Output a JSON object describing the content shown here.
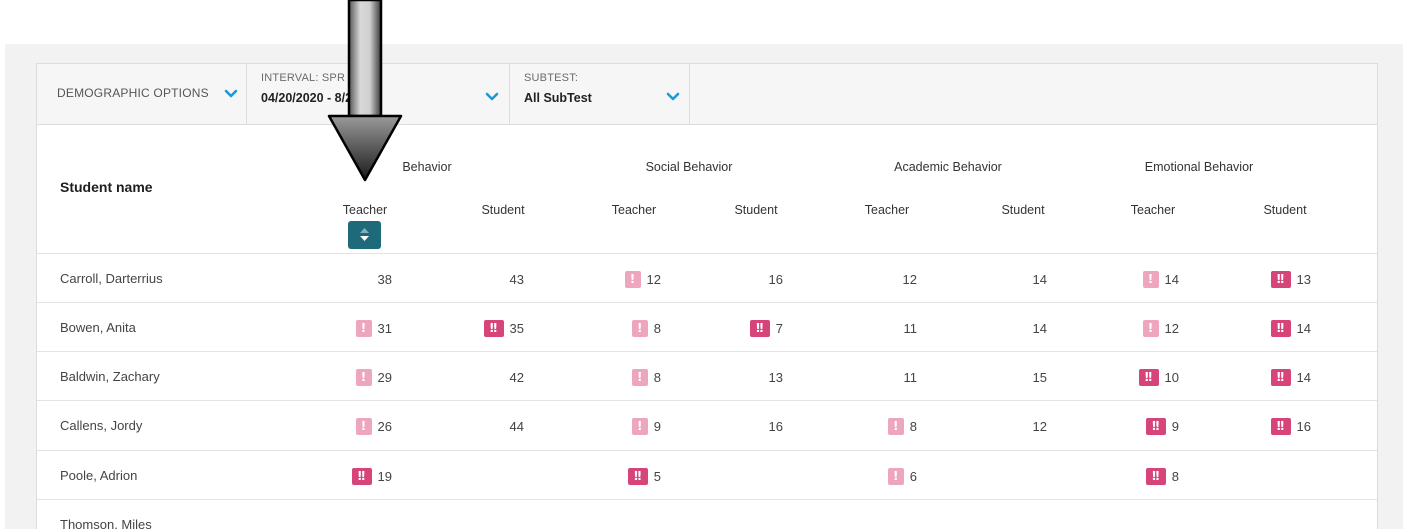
{
  "filters": {
    "demographic": {
      "label": "DEMOGRAPHIC OPTIONS"
    },
    "interval": {
      "label": "INTERVAL: SPR",
      "value": "04/20/2020 - 8/2020"
    },
    "subtest": {
      "label": "SUBTEST:",
      "value": "All SubTest"
    }
  },
  "table": {
    "name_header": "Student name",
    "groups": [
      "Behavior",
      "Social Behavior",
      "Academic Behavior",
      "Emotional Behavior"
    ],
    "subheaders": [
      "Teacher",
      "Student",
      "Teacher",
      "Student",
      "Teacher",
      "Student",
      "Teacher",
      "Student"
    ],
    "rows": [
      {
        "name": "Carroll, Darterrius",
        "cells": [
          {
            "v": "38",
            "f": ""
          },
          {
            "v": "43",
            "f": ""
          },
          {
            "v": "12",
            "f": "!"
          },
          {
            "v": "16",
            "f": ""
          },
          {
            "v": "12",
            "f": ""
          },
          {
            "v": "14",
            "f": ""
          },
          {
            "v": "14",
            "f": "!"
          },
          {
            "v": "13",
            "f": "!!"
          }
        ]
      },
      {
        "name": "Bowen, Anita",
        "cells": [
          {
            "v": "31",
            "f": "!"
          },
          {
            "v": "35",
            "f": "!!"
          },
          {
            "v": "8",
            "f": "!"
          },
          {
            "v": "7",
            "f": "!!"
          },
          {
            "v": "11",
            "f": ""
          },
          {
            "v": "14",
            "f": ""
          },
          {
            "v": "12",
            "f": "!"
          },
          {
            "v": "14",
            "f": "!!"
          }
        ]
      },
      {
        "name": "Baldwin, Zachary",
        "cells": [
          {
            "v": "29",
            "f": "!"
          },
          {
            "v": "42",
            "f": ""
          },
          {
            "v": "8",
            "f": "!"
          },
          {
            "v": "13",
            "f": ""
          },
          {
            "v": "11",
            "f": ""
          },
          {
            "v": "15",
            "f": ""
          },
          {
            "v": "10",
            "f": "!!"
          },
          {
            "v": "14",
            "f": "!!"
          }
        ]
      },
      {
        "name": "Callens, Jordy",
        "cells": [
          {
            "v": "26",
            "f": "!"
          },
          {
            "v": "44",
            "f": ""
          },
          {
            "v": "9",
            "f": "!"
          },
          {
            "v": "16",
            "f": ""
          },
          {
            "v": "8",
            "f": "!"
          },
          {
            "v": "12",
            "f": ""
          },
          {
            "v": "9",
            "f": "!!"
          },
          {
            "v": "16",
            "f": "!!"
          }
        ]
      },
      {
        "name": "Poole, Adrion",
        "cells": [
          {
            "v": "19",
            "f": "!!"
          },
          {
            "v": "",
            "f": ""
          },
          {
            "v": "5",
            "f": "!!"
          },
          {
            "v": "",
            "f": ""
          },
          {
            "v": "6",
            "f": "!"
          },
          {
            "v": "",
            "f": ""
          },
          {
            "v": "8",
            "f": "!!"
          },
          {
            "v": "",
            "f": ""
          }
        ]
      },
      {
        "name": "Thomson, Miles",
        "cells": [
          {
            "v": "",
            "f": ""
          },
          {
            "v": "",
            "f": ""
          },
          {
            "v": "",
            "f": ""
          },
          {
            "v": "",
            "f": ""
          },
          {
            "v": "",
            "f": ""
          },
          {
            "v": "",
            "f": ""
          },
          {
            "v": "",
            "f": ""
          },
          {
            "v": "",
            "f": ""
          }
        ]
      }
    ]
  },
  "icons": {
    "chevron": "chevron-down-icon",
    "sort": "sort-toggle-icon",
    "flag_warning": "warning-flag-icon",
    "flag_critical": "critical-flag-icon",
    "annotation": "arrow-down-icon"
  },
  "colors": {
    "accent": "#1a9bd7",
    "sort_button": "#1f6a7a",
    "flag_light": "#eea6bf",
    "flag_dark": "#d6447a"
  }
}
